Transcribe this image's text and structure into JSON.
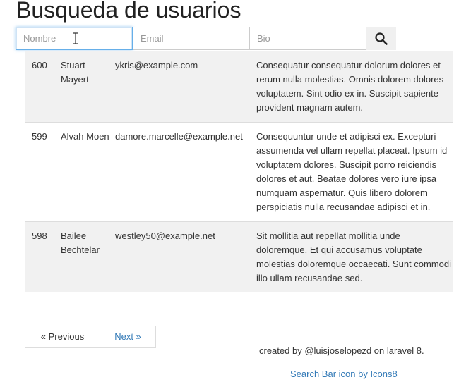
{
  "page": {
    "title": "Busqueda de usuarios"
  },
  "search": {
    "name_placeholder": "Nombre",
    "email_placeholder": "Email",
    "bio_placeholder": "Bio",
    "button_icon": "search-icon"
  },
  "users": [
    {
      "id": "600",
      "name": "Stuart Mayert",
      "email": "ykris@example.com",
      "bio": "Consequatur consequatur dolorum dolores et rerum nulla molestias. Omnis dolorem dolores voluptatem. Sint odio ex in. Suscipit sapiente provident magnam autem."
    },
    {
      "id": "599",
      "name": "Alvah Moen",
      "email": "damore.marcelle@example.net",
      "bio": "Consequuntur unde et adipisci ex. Excepturi assumenda vel ullam repellat placeat. Ipsum id voluptatem dolores. Suscipit porro reiciendis dolores et aut. Beatae dolores vero iure ipsa numquam aspernatur. Quis libero dolorem perspiciatis nulla recusandae adipisci et in."
    },
    {
      "id": "598",
      "name": "Bailee Bechtelar",
      "email": "westley50@example.net",
      "bio": "Sit mollitia aut repellat mollitia unde doloremque. Et qui accusamus voluptate molestias doloremque occaecati. Sunt commodi illo ullam recusandae sed."
    }
  ],
  "pagination": {
    "previous": "« Previous",
    "next": "Next »"
  },
  "footer": {
    "credit": "created by @luisjoselopezd on laravel 8.",
    "icon_credit": "Search Bar icon by Icons8"
  },
  "colors": {
    "link": "#337ab7",
    "stripe": "#f1f1f1",
    "focus_border": "#66afe9"
  }
}
